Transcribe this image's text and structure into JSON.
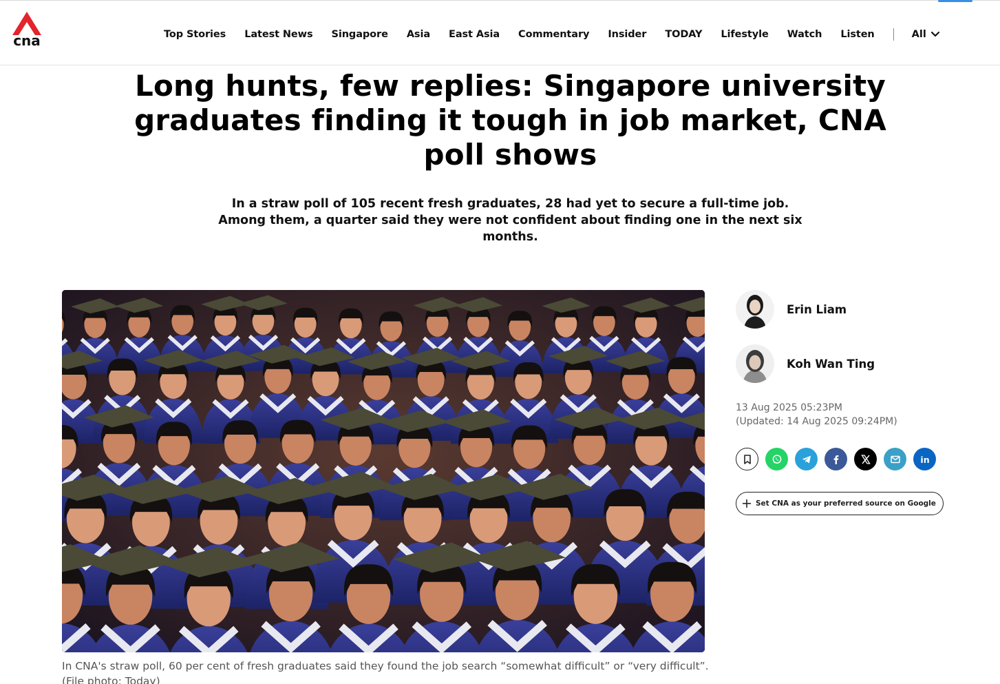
{
  "brand": {
    "logo_text": "cna",
    "logo_color": "#e3242b"
  },
  "nav": {
    "items": [
      {
        "label": "Top Stories"
      },
      {
        "label": "Latest News"
      },
      {
        "label": "Singapore"
      },
      {
        "label": "Asia"
      },
      {
        "label": "East Asia"
      },
      {
        "label": "Commentary"
      },
      {
        "label": "Insider"
      },
      {
        "label": "TODAY"
      },
      {
        "label": "Lifestyle"
      },
      {
        "label": "Watch"
      },
      {
        "label": "Listen"
      }
    ],
    "all_label": "All",
    "all_icon": "chevron-down-icon"
  },
  "article": {
    "headline": "Long hunts, few replies: Singapore university graduates finding it tough in job market, CNA poll shows",
    "standfirst": "In a straw poll of 105 recent fresh graduates, 28 had yet to secure a full-time job. Among them, a quarter said they were not confident about finding one in the next six months.",
    "hero_caption": "In CNA's straw poll, 60 per cent of fresh graduates said they found the job search “somewhat difficult” or “very difficult”. (File photo: Today)"
  },
  "authors": [
    {
      "name": "Erin Liam"
    },
    {
      "name": "Koh Wan Ting"
    }
  ],
  "dates": {
    "published": "13 Aug 2025 05:23PM",
    "updated": "(Updated: 14 Aug 2025 09:24PM)"
  },
  "share": {
    "buttons": [
      {
        "icon": "bookmark-icon",
        "color": "#ffffff"
      },
      {
        "icon": "whatsapp-icon",
        "color": "#25d366"
      },
      {
        "icon": "telegram-icon",
        "color": "#2aa1da"
      },
      {
        "icon": "facebook-icon",
        "color": "#3b5998"
      },
      {
        "icon": "x-icon",
        "color": "#000000"
      },
      {
        "icon": "email-icon",
        "color": "#3aa0c8"
      },
      {
        "icon": "linkedin-icon",
        "color": "#0a66c2"
      }
    ]
  },
  "preferred_source": {
    "label": "Set CNA as your preferred source on Google",
    "icon": "plus-icon"
  }
}
